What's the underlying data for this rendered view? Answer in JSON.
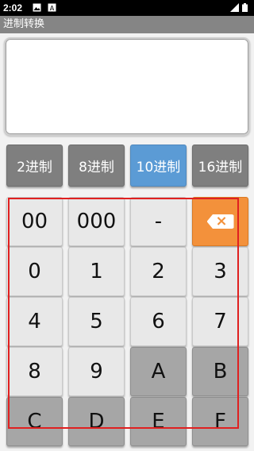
{
  "status_bar": {
    "time": "2:02",
    "icons": [
      "image-icon",
      "text-a-icon",
      "signal-icon",
      "battery-icon"
    ]
  },
  "app": {
    "title": "进制转换"
  },
  "display": {
    "value": ""
  },
  "base_buttons": [
    {
      "label": "2进制",
      "active": false
    },
    {
      "label": "8进制",
      "active": false
    },
    {
      "label": "10进制",
      "active": true
    },
    {
      "label": "16进制",
      "active": false
    }
  ],
  "keys": [
    {
      "label": "00"
    },
    {
      "label": "000"
    },
    {
      "label": "-"
    },
    {
      "label": "",
      "icon": "backspace-icon"
    },
    {
      "label": "0"
    },
    {
      "label": "1"
    },
    {
      "label": "2"
    },
    {
      "label": "3"
    },
    {
      "label": "4"
    },
    {
      "label": "5"
    },
    {
      "label": "6"
    },
    {
      "label": "7"
    },
    {
      "label": "8"
    },
    {
      "label": "9"
    },
    {
      "label": "A"
    },
    {
      "label": "B"
    },
    {
      "label": "C"
    },
    {
      "label": "D"
    },
    {
      "label": "E"
    },
    {
      "label": "F"
    }
  ],
  "colors": {
    "active_base": "#5b9bd5",
    "backspace_key": "#f3913b",
    "hex_key": "#a6a6a6",
    "digit_key": "#e8e8e8",
    "annotation_box": "#e02020"
  }
}
